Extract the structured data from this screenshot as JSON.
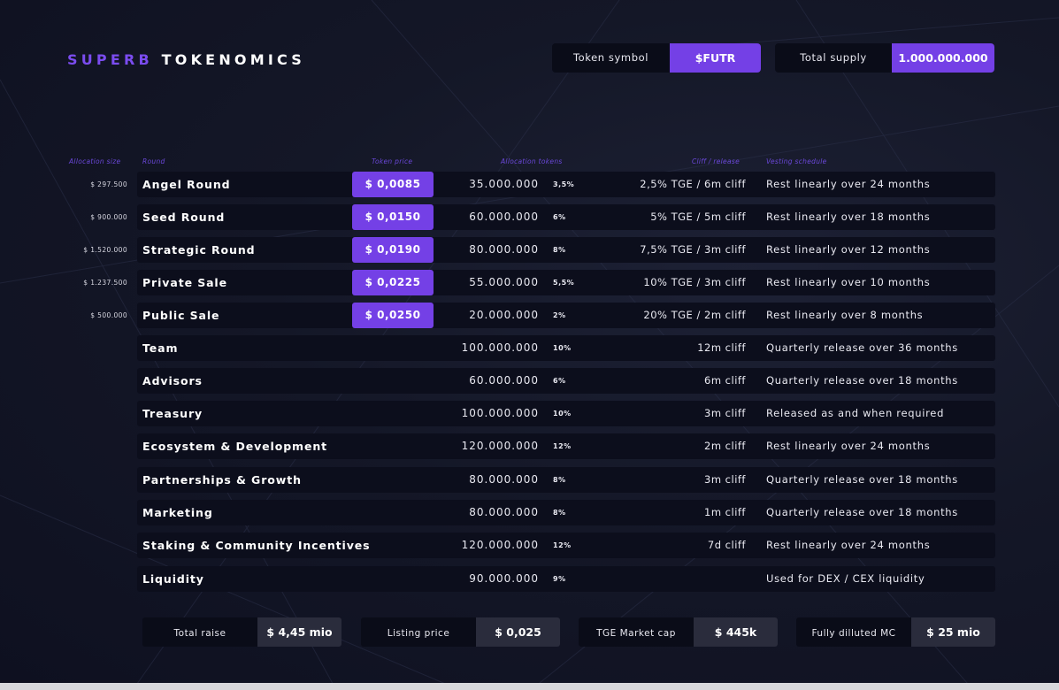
{
  "brand": {
    "part1": "SUPERB",
    "part2": "TOKENOMICS"
  },
  "token_symbol": {
    "label": "Token symbol",
    "value": "$FUTR"
  },
  "total_supply": {
    "label": "Total supply",
    "value": "1.000.000.000"
  },
  "headers": {
    "allocation_size": "Allocation size",
    "round": "Round",
    "token_price": "Token price",
    "allocation_tokens": "Allocation tokens",
    "cliff_release": "Cliff / release",
    "vesting_schedule": "Vesting schedule"
  },
  "rows": [
    {
      "alloc": "$ 297.500",
      "round": "Angel Round",
      "price": "$ 0,0085",
      "tokens": "35.000.000",
      "pct": "3,5%",
      "cliff": "2,5% TGE / 6m cliff",
      "vesting": "Rest linearly over 24 months"
    },
    {
      "alloc": "$ 900.000",
      "round": "Seed Round",
      "price": "$ 0,0150",
      "tokens": "60.000.000",
      "pct": "6%",
      "cliff": "5% TGE / 5m cliff",
      "vesting": "Rest linearly over 18 months"
    },
    {
      "alloc": "$ 1.520.000",
      "round": "Strategic Round",
      "price": "$ 0,0190",
      "tokens": "80.000.000",
      "pct": "8%",
      "cliff": "7,5% TGE / 3m cliff",
      "vesting": "Rest linearly over 12 months"
    },
    {
      "alloc": "$ 1.237.500",
      "round": "Private Sale",
      "price": "$ 0,0225",
      "tokens": "55.000.000",
      "pct": "5,5%",
      "cliff": "10% TGE / 3m cliff",
      "vesting": "Rest linearly over 10 months"
    },
    {
      "alloc": "$ 500.000",
      "round": "Public Sale",
      "price": "$ 0,0250",
      "tokens": "20.000.000",
      "pct": "2%",
      "cliff": "20% TGE / 2m cliff",
      "vesting": "Rest linearly over 8 months"
    },
    {
      "alloc": "",
      "round": "Team",
      "price": "",
      "tokens": "100.000.000",
      "pct": "10%",
      "cliff": "12m cliff",
      "vesting": "Quarterly release over 36 months"
    },
    {
      "alloc": "",
      "round": "Advisors",
      "price": "",
      "tokens": "60.000.000",
      "pct": "6%",
      "cliff": "6m cliff",
      "vesting": "Quarterly release over 18 months"
    },
    {
      "alloc": "",
      "round": "Treasury",
      "price": "",
      "tokens": "100.000.000",
      "pct": "10%",
      "cliff": "3m cliff",
      "vesting": "Released as and when required"
    },
    {
      "alloc": "",
      "round": "Ecosystem & Development",
      "price": "",
      "tokens": "120.000.000",
      "pct": "12%",
      "cliff": "2m cliff",
      "vesting": "Rest linearly over 24 months"
    },
    {
      "alloc": "",
      "round": "Partnerships & Growth",
      "price": "",
      "tokens": "80.000.000",
      "pct": "8%",
      "cliff": "3m cliff",
      "vesting": "Quarterly release over 18 months"
    },
    {
      "alloc": "",
      "round": "Marketing",
      "price": "",
      "tokens": "80.000.000",
      "pct": "8%",
      "cliff": "1m cliff",
      "vesting": "Quarterly release over 18 months"
    },
    {
      "alloc": "",
      "round": "Staking & Community Incentives",
      "price": "",
      "tokens": "120.000.000",
      "pct": "12%",
      "cliff": "7d cliff",
      "vesting": "Rest linearly over 24 months"
    },
    {
      "alloc": "",
      "round": "Liquidity",
      "price": "",
      "tokens": "90.000.000",
      "pct": "9%",
      "cliff": "",
      "vesting": "Used for DEX / CEX liquidity"
    }
  ],
  "stats": [
    {
      "label": "Total raise",
      "value": "$ 4,45 mio"
    },
    {
      "label": "Listing price",
      "value": "$ 0,025"
    },
    {
      "label": "TGE Market cap",
      "value": "$ 445k"
    },
    {
      "label": "Fully dilluted MC",
      "value": "$ 25 mio"
    }
  ],
  "colors": {
    "accent": "#7440e6",
    "background": "#141727",
    "row": "#0c0e1c",
    "stat_value": "#2a2c3c"
  }
}
